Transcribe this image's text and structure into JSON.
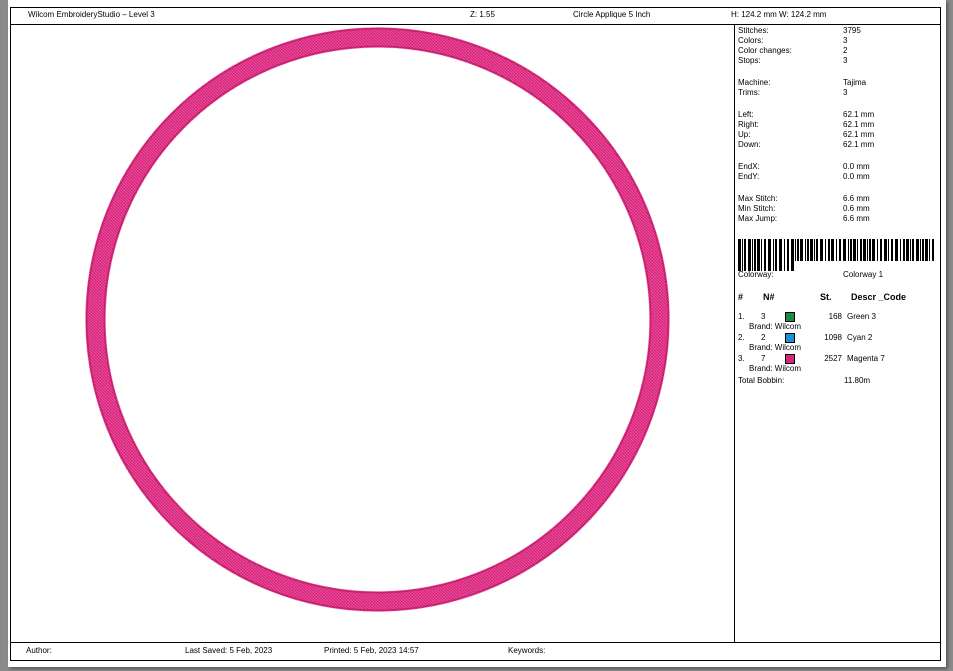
{
  "header": {
    "app_title": "Wilcom EmbroideryStudio – Level 3",
    "zoom": "Z: 1.55",
    "design_name": "Circle Applique 5 Inch",
    "size": "H: 124.2 mm   W: 124.2 mm"
  },
  "stats": [
    {
      "label": "Stitches:",
      "value": "3795"
    },
    {
      "label": "Colors:",
      "value": "3"
    },
    {
      "label": "Color changes:",
      "value": "2"
    },
    {
      "label": "Stops:",
      "value": "3"
    },
    {
      "label": "Machine:",
      "value": "Tajima"
    },
    {
      "label": "Trims:",
      "value": "3"
    },
    {
      "label": "Left:",
      "value": "62.1 mm"
    },
    {
      "label": "Right:",
      "value": "62.1 mm"
    },
    {
      "label": "Up:",
      "value": "62.1 mm"
    },
    {
      "label": "Down:",
      "value": "62.1 mm"
    },
    {
      "label": "EndX:",
      "value": "0.0 mm"
    },
    {
      "label": "EndY:",
      "value": "0.0 mm"
    },
    {
      "label": "Max Stitch:",
      "value": "6.6 mm"
    },
    {
      "label": "Min Stitch:",
      "value": "0.6 mm"
    },
    {
      "label": "Max Jump:",
      "value": "6.6 mm"
    }
  ],
  "colorway": {
    "label": "Colorway:",
    "value": "Colorway 1"
  },
  "color_table": {
    "headers": {
      "num": "#",
      "n": "N#",
      "st": "St.",
      "descr": "Descr _Code"
    },
    "rows": [
      {
        "idx": "1.",
        "n": "3",
        "color": "#1e8a4a",
        "st": "168",
        "descr": "Green 3",
        "brand": "Brand: Wilcom"
      },
      {
        "idx": "2.",
        "n": "2",
        "color": "#1f8fd1",
        "st": "1098",
        "descr": "Cyan 2",
        "brand": "Brand: Wilcom"
      },
      {
        "idx": "3.",
        "n": "7",
        "color": "#d5267a",
        "st": "2527",
        "descr": "Magenta 7",
        "brand": "Brand: Wilcom"
      }
    ],
    "total_bobbin_label": "Total Bobbin:",
    "total_bobbin_value": "11.80m"
  },
  "footer": {
    "author": "Author:",
    "last_saved": "Last Saved:  5 Feb, 2023",
    "printed": "Printed:  5 Feb, 2023 14:57",
    "keywords": "Keywords:"
  },
  "colors": {
    "ring": "#d9287e",
    "ring_dark": "#c81f6f",
    "ring_light": "#ee6aa8"
  }
}
